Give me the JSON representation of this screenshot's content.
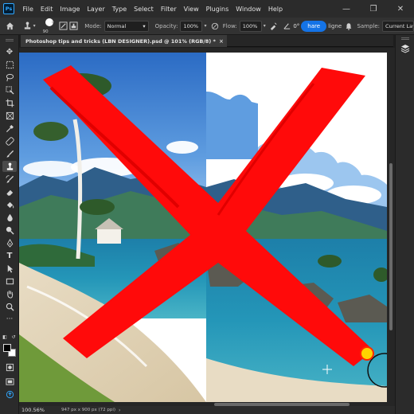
{
  "app": {
    "logo_text": "Ps"
  },
  "menu": {
    "items": [
      "File",
      "Edit",
      "Image",
      "Layer",
      "Type",
      "Select",
      "Filter",
      "View",
      "Plugins",
      "Window",
      "Help"
    ]
  },
  "window_controls": {
    "minimize": "—",
    "maximize": "❐",
    "close": "✕"
  },
  "options": {
    "brush_size": "90",
    "mode_label": "Mode:",
    "mode_value": "Normal",
    "opacity_label": "Opacity:",
    "opacity_value": "100%",
    "flow_label": "Flow:",
    "flow_value": "100%",
    "angle_value": "0°",
    "share_label": "hare",
    "align_label": "ligne",
    "sample_label": "Sample:",
    "sample_value": "Current Laye"
  },
  "document": {
    "tab_title": "Photoshop tips and tricks (LBN DESIGNER).psd @ 101% (RGB/8) *",
    "close_icon": "×"
  },
  "status": {
    "zoom": "100.56%",
    "doc_info": "947 px x 900 px (72 ppi)",
    "arrow": "›"
  },
  "colors": {
    "accent": "#1473e6",
    "red_x": "#ff0a0a",
    "cursor_yellow": "#ffd400"
  }
}
